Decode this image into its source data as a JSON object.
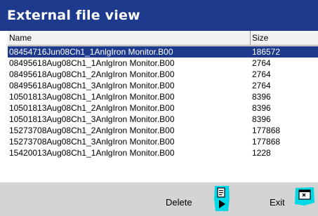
{
  "window": {
    "title": "External file view"
  },
  "columns": {
    "name": "Name",
    "size": "Size"
  },
  "files": [
    {
      "name": "08454716Jun08Ch1_1AnlgIron Monitor.B00",
      "size": "186572",
      "selected": true
    },
    {
      "name": "08495618Aug08Ch1_1AnlgIron Monitor.B00",
      "size": "2764",
      "selected": false
    },
    {
      "name": "08495618Aug08Ch1_2AnlgIron Monitor.B00",
      "size": "2764",
      "selected": false
    },
    {
      "name": "08495618Aug08Ch1_3AnlgIron Monitor.B00",
      "size": "2764",
      "selected": false
    },
    {
      "name": "10501813Aug08Ch1_1AnlgIron Monitor.B00",
      "size": "8396",
      "selected": false
    },
    {
      "name": "10501813Aug08Ch1_2AnlgIron Monitor.B00",
      "size": "8396",
      "selected": false
    },
    {
      "name": "10501813Aug08Ch1_3AnlgIron Monitor.B00",
      "size": "8396",
      "selected": false
    },
    {
      "name": "15273708Aug08Ch1_2AnlgIron Monitor.B00",
      "size": "177868",
      "selected": false
    },
    {
      "name": "15273708Aug08Ch1_3AnlgIron Monitor.B00",
      "size": "177868",
      "selected": false
    },
    {
      "name": "15420013Aug08Ch1_1AnlgIron Monitor.B00",
      "size": "1228",
      "selected": false
    }
  ],
  "toolbar": {
    "delete_label": "Delete",
    "exit_label": "Exit",
    "delete_icon": "delete-doc-icon",
    "exit_icon": "exit-window-icon"
  },
  "colors": {
    "titlebar": "#1e3a8c",
    "selection": "#1e3a8c",
    "toolbar": "#d4d4d4",
    "icon_highlight": "#00d8e8"
  }
}
